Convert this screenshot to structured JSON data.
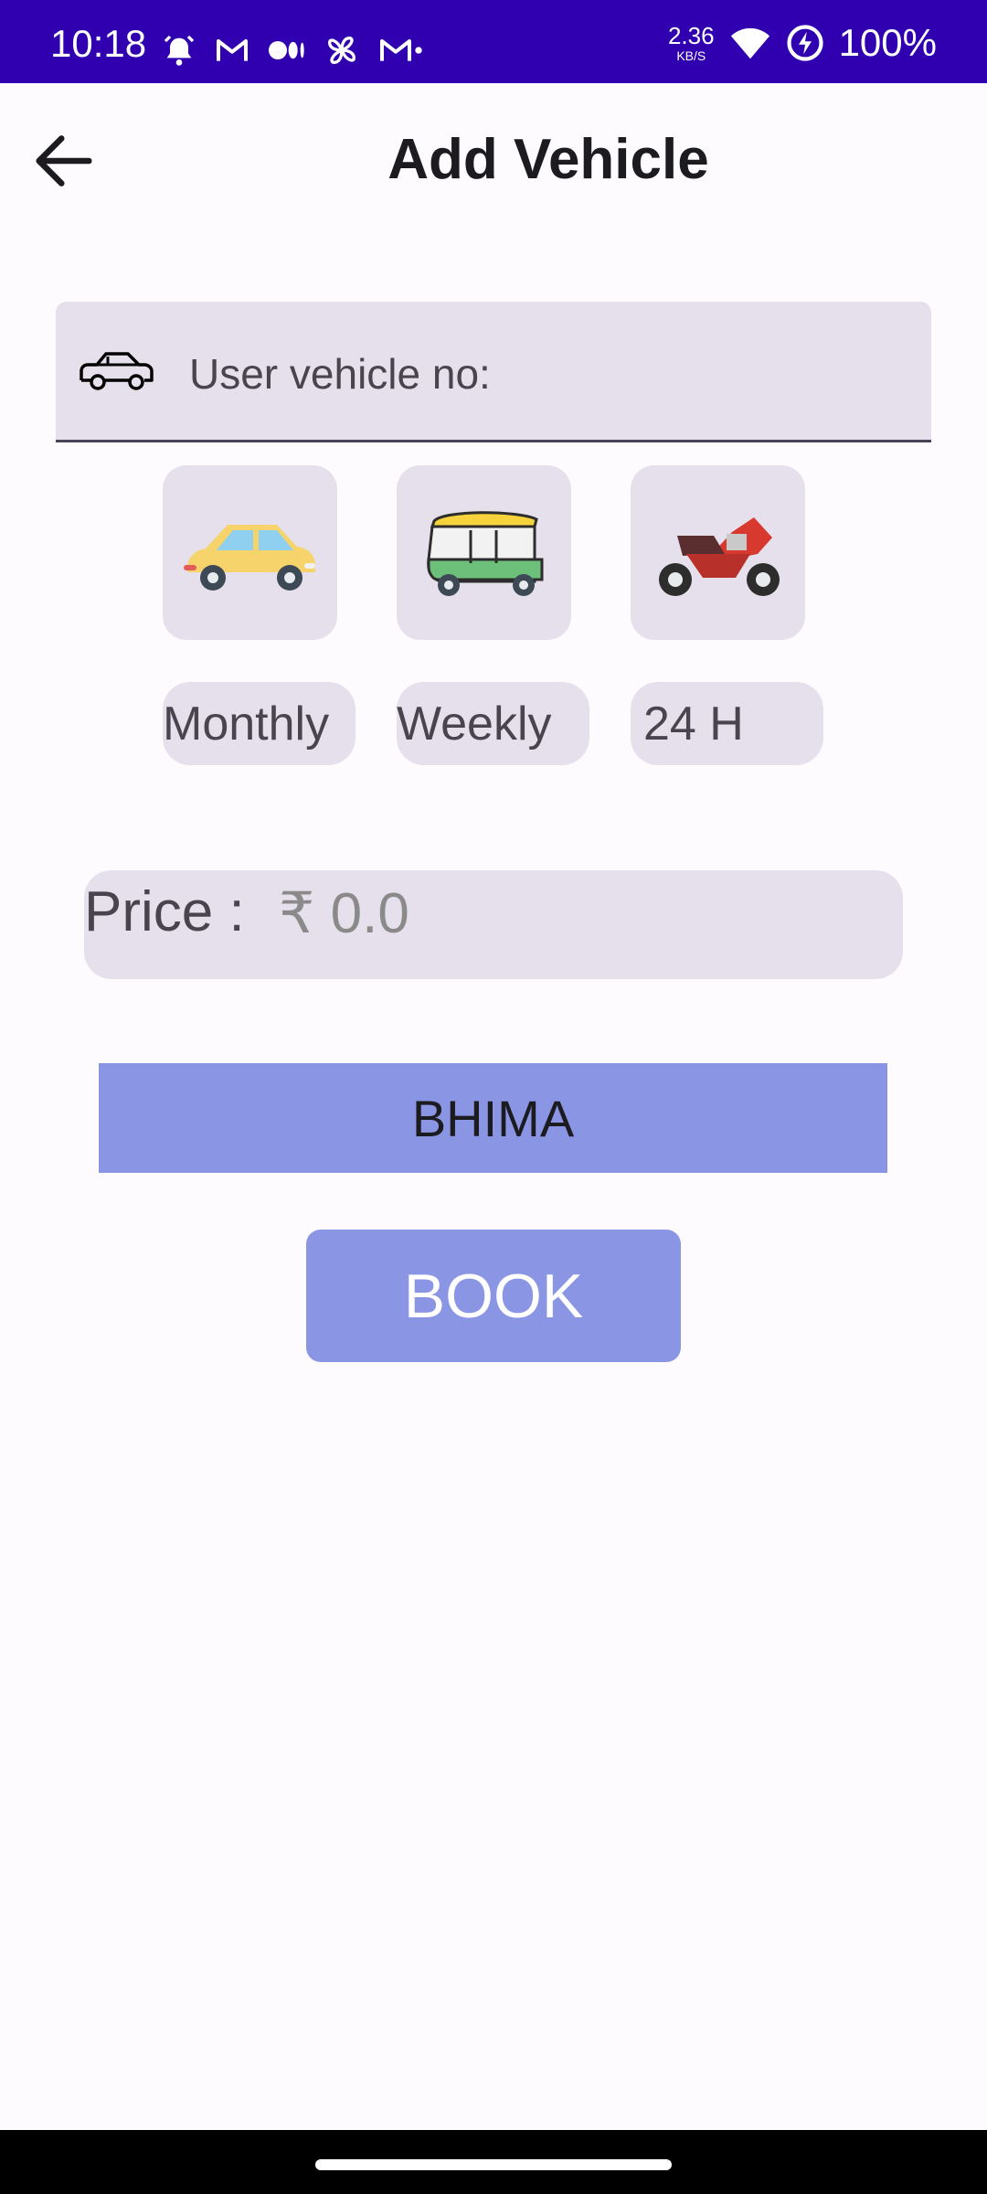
{
  "status_bar": {
    "time": "10:18",
    "net_speed_value": "2.36",
    "net_speed_unit": "KB/S",
    "battery": "100%",
    "icons": [
      "alarm-icon",
      "gmail-icon",
      "medium-icon",
      "pinwheel-icon",
      "gmail-icon",
      "wifi-icon",
      "battery-saver-icon"
    ]
  },
  "app_bar": {
    "title": "Add Vehicle",
    "back_icon": "arrow-left-icon"
  },
  "vehicle_input": {
    "placeholder": "User vehicle no:",
    "icon": "car-outline-icon"
  },
  "vehicle_types": [
    {
      "name": "car",
      "icon": "car-icon"
    },
    {
      "name": "auto-rickshaw",
      "icon": "auto-rickshaw-icon"
    },
    {
      "name": "motorbike",
      "icon": "motorbike-icon"
    }
  ],
  "durations": [
    "Monthly",
    "Weekly",
    "24 H"
  ],
  "price": {
    "label": "Price :",
    "value": "₹ 0.0"
  },
  "name_button": "BHIMA",
  "book_button": "BOOK",
  "colors": {
    "status_bar": "#3000b0",
    "accent_button": "#8a96e4",
    "surface_variant": "#e6e0ec",
    "background": "#fdfbfe"
  }
}
